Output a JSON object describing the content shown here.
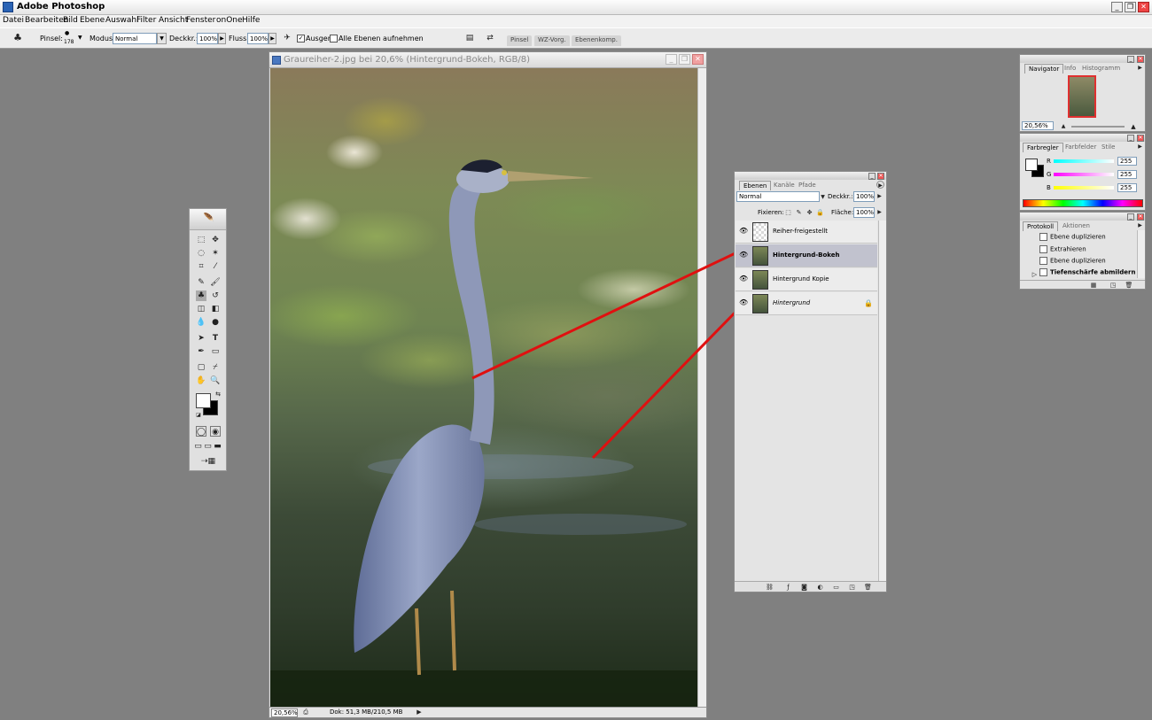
{
  "app": {
    "title": "Adobe Photoshop"
  },
  "menu": [
    "Datei",
    "Bearbeiten",
    "Bild",
    "Ebene",
    "Auswahl",
    "Filter",
    "Ansicht",
    "Fenster",
    "onOne",
    "Hilfe"
  ],
  "options": {
    "pinsel_label": "Pinsel:",
    "pinsel_size": "178",
    "modus_label": "Modus:",
    "modus_value": "Normal",
    "deckkr_label": "Deckkr.:",
    "deckkr_value": "100%",
    "fluss_label": "Fluss:",
    "fluss_value": "100%",
    "ausger_label": "Ausger.",
    "alle_ebenen_label": "Alle Ebenen aufnehmen",
    "well_tabs": [
      "Pinsel",
      "WZ-Vorg.",
      "Ebenenkomp."
    ]
  },
  "document": {
    "title": "Graureiher-2.jpg bei 20,6% (Hintergrund-Bokeh, RGB/8)",
    "zoom": "20,56%",
    "dok": "Dok: 51,3 MB/210,5 MB"
  },
  "layers_panel": {
    "tabs": [
      "Ebenen",
      "Kanäle",
      "Pfade"
    ],
    "blend_mode": "Normal",
    "deckkr_label": "Deckkr.:",
    "deckkr_value": "100%",
    "fixieren_label": "Fixieren:",
    "flaeche_label": "Fläche:",
    "flaeche_value": "100%",
    "layers": [
      {
        "name": "Reiher-freigestellt"
      },
      {
        "name": "Hintergrund-Bokeh"
      },
      {
        "name": "Hintergrund Kopie"
      },
      {
        "name": "Hintergrund"
      }
    ]
  },
  "navigator": {
    "tabs": [
      "Navigator",
      "Info",
      "Histogramm"
    ],
    "zoom": "20,56%"
  },
  "color_panel": {
    "tabs": [
      "Farbregler",
      "Farbfelder",
      "Stile"
    ],
    "channels": [
      {
        "label": "R",
        "value": "255"
      },
      {
        "label": "G",
        "value": "255"
      },
      {
        "label": "B",
        "value": "255"
      }
    ]
  },
  "history_panel": {
    "tabs": [
      "Protokoll",
      "Aktionen"
    ],
    "items": [
      "Ebene duplizieren",
      "Extrahieren",
      "Ebene duplizieren",
      "Tiefenschärfe abmildern"
    ]
  }
}
